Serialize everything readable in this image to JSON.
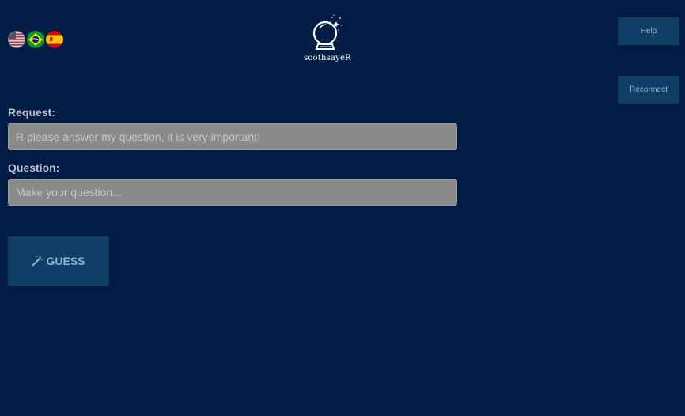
{
  "header": {
    "languages": [
      {
        "name": "English",
        "icon": "us-flag-icon"
      },
      {
        "name": "Português",
        "icon": "brazil-flag-icon"
      },
      {
        "name": "Español",
        "icon": "spain-flag-icon"
      }
    ],
    "logo_text": "soothsayeR"
  },
  "sidebar": {
    "help_label": "Help",
    "reconnect_label": "Reconnect"
  },
  "form": {
    "request_label": "Request:",
    "request_placeholder": "R please answer my question, it is very important!",
    "request_value": "",
    "question_label": "Question:",
    "question_placeholder": "Make your question...",
    "question_value": "",
    "guess_label": "GUESS",
    "guess_icon": "magic-wand-icon"
  },
  "colors": {
    "background": "#011c45",
    "button": "#0e3d66",
    "button_text": "#8fb3cf",
    "input": "#8a8a8a"
  }
}
